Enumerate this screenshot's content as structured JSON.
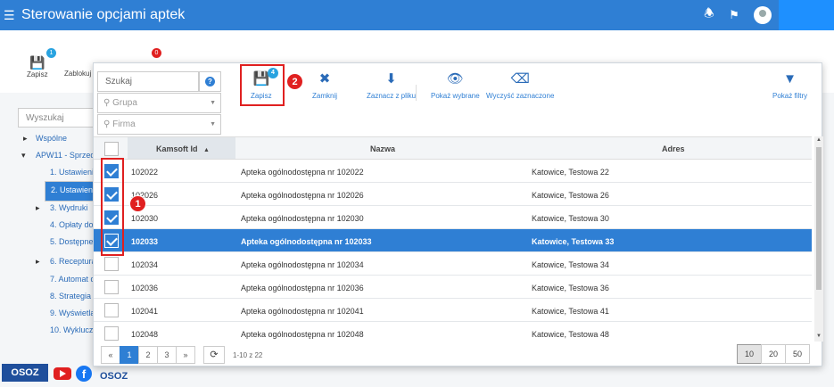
{
  "app": {
    "title": "Sterowanie opcjami aptek"
  },
  "background": {
    "toolbar": {
      "save_label": "Zapisz",
      "save_badge": "1",
      "block_label": "Zablokuj e",
      "block_badge": "0"
    },
    "search_placeholder": "Wyszukaj",
    "tree": [
      "Wspólne",
      "APW11 - Sprzeda",
      "1. Ustawienia",
      "2. Ustawienia",
      "3. Wydruki",
      "4. Opłaty dod",
      "5. Dostępne s",
      "6. Receptura",
      "7. Automat d",
      "8. Strategia r",
      "9. Wyświetla",
      "10. Wykluczo"
    ],
    "footer_logo": "OSOZ",
    "footer_logo2": "OSOZ"
  },
  "modal": {
    "search_placeholder": "Szukaj",
    "help_icon_text": "?",
    "group_placeholder": "Grupa",
    "company_placeholder": "Firma",
    "toolbar": {
      "save_label": "Zapisz",
      "save_badge": "4",
      "close_label": "Zamknij",
      "mark_from_file_label": "Zaznacz z pliku",
      "show_selected_label": "Pokaż wybrane",
      "clear_selected_label": "Wyczyść zaznaczone",
      "show_filters_label": "Pokaż filtry"
    },
    "annotations": {
      "one": "1",
      "two": "2"
    },
    "columns": {
      "id": "Kamsoft Id",
      "name": "Nazwa",
      "address": "Adres"
    },
    "rows": [
      {
        "id": "102022",
        "name": "Apteka ogólnodostępna nr 102022",
        "address": "Katowice, Testowa 22",
        "checked": true
      },
      {
        "id": "102026",
        "name": "Apteka ogólnodostępna nr 102026",
        "address": "Katowice, Testowa 26",
        "checked": true
      },
      {
        "id": "102030",
        "name": "Apteka ogólnodostępna nr 102030",
        "address": "Katowice, Testowa 30",
        "checked": true
      },
      {
        "id": "102033",
        "name": "Apteka ogólnodostępna nr 102033",
        "address": "Katowice, Testowa 33",
        "checked": true
      },
      {
        "id": "102034",
        "name": "Apteka ogólnodostępna nr 102034",
        "address": "Katowice, Testowa 34",
        "checked": false
      },
      {
        "id": "102036",
        "name": "Apteka ogólnodostępna nr 102036",
        "address": "Katowice, Testowa 36",
        "checked": false
      },
      {
        "id": "102041",
        "name": "Apteka ogólnodostępna nr 102041",
        "address": "Katowice, Testowa 41",
        "checked": false
      },
      {
        "id": "102048",
        "name": "Apteka ogólnodostępna nr 102048",
        "address": "Katowice, Testowa 48",
        "checked": false
      }
    ],
    "pager": {
      "first": "«",
      "pages": [
        "1",
        "2",
        "3"
      ],
      "last": "»",
      "range": "1-10 z 22",
      "page_sizes": [
        "10",
        "20",
        "50"
      ]
    }
  }
}
